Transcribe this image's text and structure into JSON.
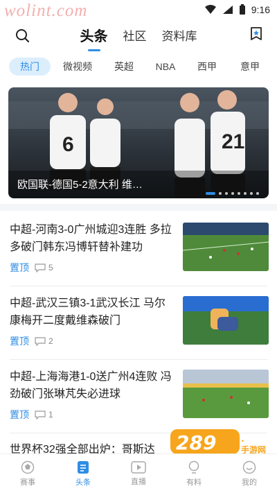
{
  "status": {
    "watermark": "wolint.com",
    "time": "9:16"
  },
  "top_tabs": [
    "头条",
    "社区",
    "资料库"
  ],
  "channels": [
    "热门",
    "微视频",
    "英超",
    "NBA",
    "西甲",
    "意甲"
  ],
  "banner": {
    "caption": "欧国联-德国5-2意大利 维…"
  },
  "news": [
    {
      "title": "中超-河南3-0广州城迎3连胜 多拉多破门韩东冯博轩替补建功",
      "tag": "置顶",
      "comments": "5"
    },
    {
      "title": "中超-武汉三镇3-1武汉长江 马尔康梅开二度戴维森破门",
      "tag": "置顶",
      "comments": "2"
    },
    {
      "title": "中超-上海海港1-0送广州4连败 冯劲破门张琳芃失必进球",
      "tag": "置顶",
      "comments": "1"
    }
  ],
  "partial_news_title": "世界杯32强全部出炉：哥斯达",
  "bottom_nav": [
    "赛事",
    "头条",
    "直播",
    "有料",
    "我的"
  ],
  "overlay_logo": {
    "number": "289",
    "sub": "手游网"
  }
}
